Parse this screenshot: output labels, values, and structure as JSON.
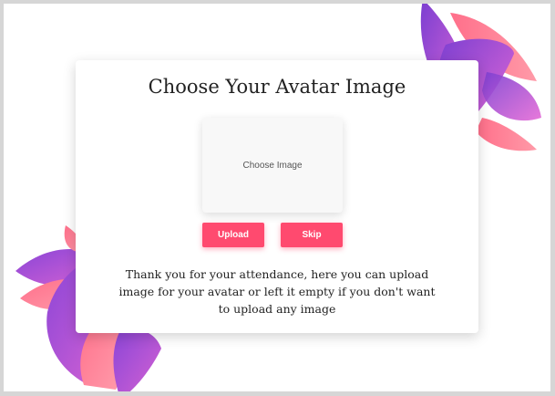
{
  "dialog": {
    "title": "Choose Your Avatar Image",
    "image_placeholder": "Choose Image",
    "upload_label": "Upload",
    "skip_label": "Skip",
    "message_lines": [
      "Thank you for your attendance, here you can upload",
      "image  for your avatar or left it empty if you don't want",
      "to upload any image"
    ]
  },
  "colors": {
    "button": "#ff4a6f",
    "petal_purple": "#9b4fd6",
    "petal_pink": "#ff7b8f"
  },
  "decorations": [
    "flower-petals-top-right",
    "flower-petals-bottom-left"
  ]
}
